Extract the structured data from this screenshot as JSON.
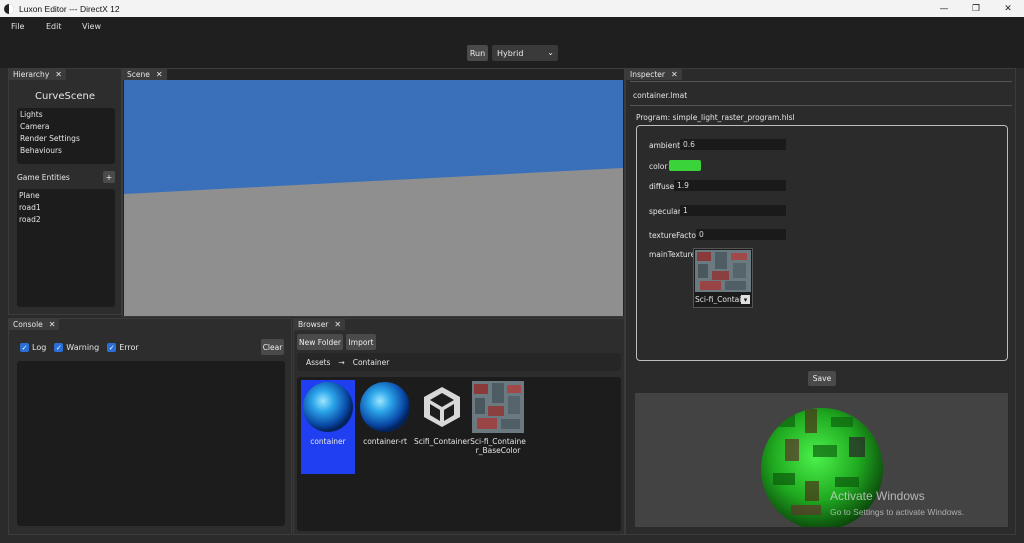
{
  "window": {
    "title": "Luxon Editor --- DirectX 12",
    "minimize": "—",
    "maximize": "❐",
    "close": "✕"
  },
  "menu": [
    "File",
    "Edit",
    "View"
  ],
  "toolbar": {
    "run_label": "Run",
    "mode": "Hybrid"
  },
  "hierarchy": {
    "tab": "Hierarchy",
    "scene_name": "CurveScene",
    "items": [
      "Lights",
      "Camera",
      "Render Settings",
      "Behaviours"
    ],
    "entities_label": "Game Entities",
    "add_label": "+",
    "entities": [
      "Plane",
      "road1",
      "road2"
    ]
  },
  "scene": {
    "tab": "Scene",
    "sky_color": "#3a70ba",
    "ground_color": "#8f8f8f"
  },
  "console": {
    "tab": "Console",
    "log": "Log",
    "warning": "Warning",
    "error": "Error",
    "clear": "Clear"
  },
  "browser": {
    "tab": "Browser",
    "new_folder": "New Folder",
    "import": "Import",
    "breadcrumb": [
      "Assets",
      "Container"
    ],
    "breadcrumb_sep": "→",
    "assets": [
      "container",
      "container-rt",
      "Scifi_Container",
      "Sci-fi_Containe r_BaseColor"
    ]
  },
  "inspector": {
    "tab": "Inspecter",
    "file": "container.lmat",
    "program": "Program: simple_light_raster_program.hlsl",
    "props": {
      "ambient_label": "ambient",
      "ambient": "0.6",
      "color_label": "color",
      "color_value": "#3ad33a",
      "diffuse_label": "diffuse",
      "diffuse": "1.9",
      "specular_label": "specular",
      "specular": "1",
      "texture_factor_label": "textureFactor",
      "texture_factor": "0",
      "main_texture_label": "mainTexture",
      "main_texture": "Sci-fi_Contai"
    },
    "save": "Save",
    "watermark_title": "Activate Windows",
    "watermark_sub": "Go to Settings to activate Windows."
  },
  "colors": {
    "accent_blue": "#2a6fd6",
    "selected_asset": "#1f3ff0"
  }
}
